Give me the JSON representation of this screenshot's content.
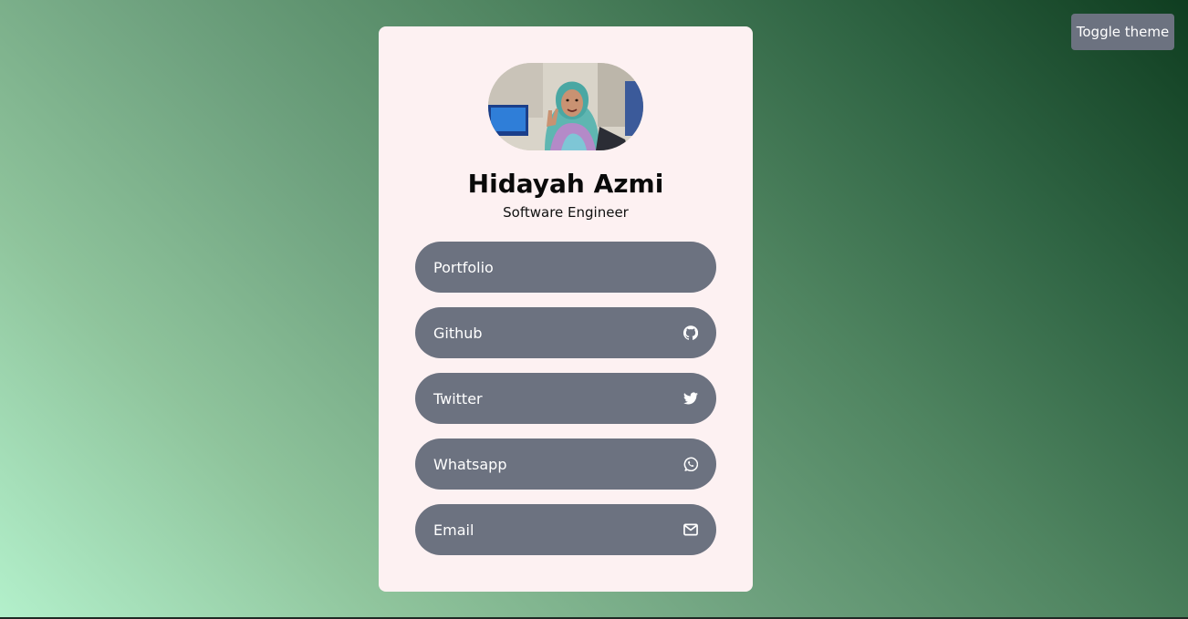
{
  "toggle": {
    "label": "Toggle theme"
  },
  "profile": {
    "name": "Hidayah Azmi",
    "role": "Software Engineer"
  },
  "links": [
    {
      "label": "Portfolio",
      "icon": ""
    },
    {
      "label": "Github",
      "icon": "github-icon"
    },
    {
      "label": "Twitter",
      "icon": "twitter-icon"
    },
    {
      "label": "Whatsapp",
      "icon": "whatsapp-icon"
    },
    {
      "label": "Email",
      "icon": "mail-icon"
    }
  ],
  "colors": {
    "card": "#fdf1f2",
    "button": "#6c7280",
    "accent_dark": "#0f3d20",
    "accent_light": "#b3f0cb"
  }
}
